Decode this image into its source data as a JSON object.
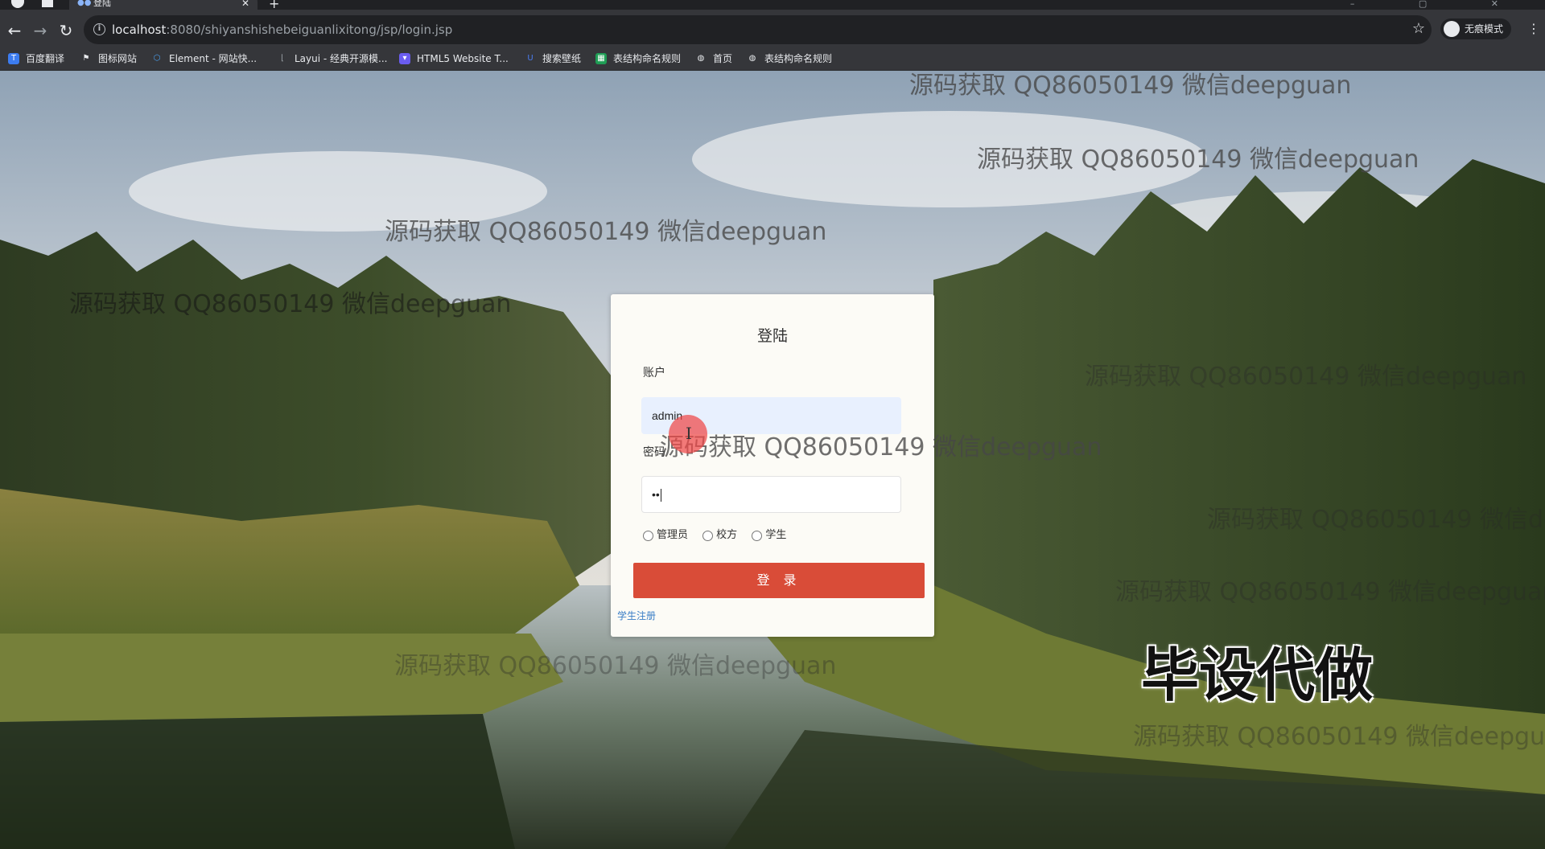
{
  "browser": {
    "tab_title": "登陆",
    "url_host": "localhost",
    "url_path": ":8080/shiyanshishebeiguanlixitong/jsp/login.jsp",
    "profile_label": "无痕模式",
    "icons": [
      "back-icon",
      "forward-icon",
      "reload-icon",
      "info-icon",
      "star-icon",
      "incognito-icon",
      "menu-dots-icon"
    ]
  },
  "bookmarks": [
    {
      "label": "百度翻译",
      "color": "#3c7cf0"
    },
    {
      "label": "图标网站",
      "color": "#e8eaed"
    },
    {
      "label": "Element - 网站快...",
      "color": "#4aa0f0"
    },
    {
      "label": "Layui - 经典开源模...",
      "color": "#9aa0a6"
    },
    {
      "label": "HTML5 Website T...",
      "color": "#6a5cf0"
    },
    {
      "label": "搜索壁纸",
      "color": "#4a7cf0"
    },
    {
      "label": "表结构命名规则",
      "color": "#1f9d55"
    },
    {
      "label": "首页",
      "color": "#e8eaed"
    },
    {
      "label": "表结构命名规则",
      "color": "#e8eaed"
    }
  ],
  "login": {
    "title": "登陆",
    "account_label": "账户",
    "account_value": "admin",
    "password_label": "密码",
    "password_value": "••",
    "roles": [
      "管理员",
      "校方",
      "学生"
    ],
    "submit_label": "登 录",
    "register_link": "学生注册"
  },
  "overlay": {
    "watermark_text": "源码获取 QQ86050149 微信deepguan",
    "stamp_text": "毕设代做"
  },
  "colors": {
    "primary_button": "#d94c38",
    "link": "#3a7ec6",
    "autofill_bg": "#e8f0fe"
  }
}
